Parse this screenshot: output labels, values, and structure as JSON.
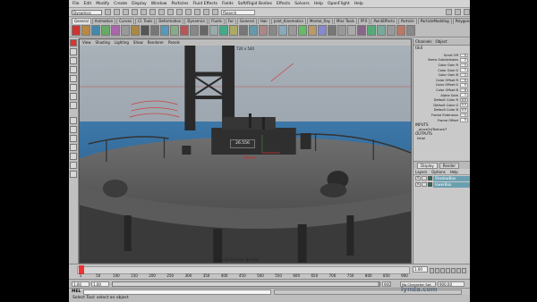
{
  "menubar": [
    "File",
    "Edit",
    "Modify",
    "Create",
    "Display",
    "Window",
    "Particles",
    "Fluid Effects",
    "Fields",
    "Soft/Rigid Bodies",
    "Effects",
    "Solvers",
    "Help",
    "OpenFlight",
    "Help"
  ],
  "statusline": {
    "mode": "Dynamics",
    "field_placeholder": "",
    "search_label": "fSearch"
  },
  "shelf_tabs": [
    "General",
    "Animation",
    "Curves",
    "Cl. Tools",
    "Deformation",
    "Dynamics",
    "Fluids",
    "Fur",
    "General",
    "Hair",
    "Joint_Kinematics",
    "Mental_Ray",
    "Misc Tools",
    "PFX",
    "PaintEffects",
    "Particle",
    "ParticleModding",
    "Polygons",
    "Poly",
    "Rendering",
    "SL",
    "Subdivs",
    "Surfaces",
    "Toon"
  ],
  "shelf_active_index": 0,
  "shelf_icons": [
    {
      "label": "",
      "color": "#c33"
    },
    {
      "label": "",
      "color": "#b84"
    },
    {
      "label": "",
      "color": "#48a"
    },
    {
      "label": "",
      "color": "#6a6"
    },
    {
      "label": "",
      "color": "#a6a"
    },
    {
      "label": "",
      "color": "#999"
    },
    {
      "label": "",
      "color": "#a84"
    },
    {
      "label": "",
      "color": "#555"
    },
    {
      "label": "",
      "color": "#777"
    },
    {
      "label": "",
      "color": "#59b"
    },
    {
      "label": "",
      "color": "#8a8"
    },
    {
      "label": "",
      "color": "#b55"
    },
    {
      "label": "",
      "color": "#888"
    },
    {
      "label": "",
      "color": "#666"
    },
    {
      "label": "",
      "color": "#9aa"
    },
    {
      "label": "",
      "color": "#4a8"
    },
    {
      "label": "",
      "color": "#aa6"
    },
    {
      "label": "",
      "color": "#777"
    },
    {
      "label": "",
      "color": "#69a"
    },
    {
      "label": "",
      "color": "#a88"
    },
    {
      "label": "",
      "color": "#888"
    },
    {
      "label": "",
      "color": "#8ab"
    },
    {
      "label": "",
      "color": "#999"
    },
    {
      "label": "",
      "color": "#6b6"
    },
    {
      "label": "",
      "color": "#b96"
    },
    {
      "label": "",
      "color": "#88c"
    },
    {
      "label": "",
      "color": "#777"
    },
    {
      "label": "",
      "color": "#999"
    },
    {
      "label": "",
      "color": "#aaa"
    },
    {
      "label": "",
      "color": "#868"
    },
    {
      "label": "",
      "color": "#5a7"
    },
    {
      "label": "",
      "color": "#7a9"
    },
    {
      "label": "",
      "color": "#999"
    },
    {
      "label": "",
      "color": "#b76"
    },
    {
      "label": "",
      "color": "#888"
    }
  ],
  "viewport": {
    "menu": [
      "View",
      "Shading",
      "Lighting",
      "Show",
      "Renderer",
      "Panels"
    ],
    "resolution": "720 x 540",
    "hud_readout": "26.556",
    "hud_label": "Move",
    "camera_label": ""
  },
  "channel_box": {
    "tabs": [
      "Channels",
      "Object"
    ],
    "object_name": "tikiI",
    "attributes": [
      {
        "name": "Scroll Off",
        "value": "0"
      },
      {
        "name": "Items Subdivisions",
        "value": "2"
      },
      {
        "name": "Color Gain R",
        "value": "1"
      },
      {
        "name": "Color Gain G",
        "value": "1"
      },
      {
        "name": "Color Gain B",
        "value": "1"
      },
      {
        "name": "Color Offset R",
        "value": "0"
      },
      {
        "name": "Color Offset G",
        "value": "0"
      },
      {
        "name": "Color Offset B",
        "value": "0"
      },
      {
        "name": "Alpha Gain",
        "value": "1"
      },
      {
        "name": "Default Color R",
        "value": "0.5"
      },
      {
        "name": "Default Color G",
        "value": "0.5"
      },
      {
        "name": "Default Color B",
        "value": "0.5"
      },
      {
        "name": "Frame Extension",
        "value": "1"
      },
      {
        "name": "Frame Offset",
        "value": "0"
      }
    ],
    "inputs_label": "INPUTS",
    "inputs_item": "_place2dTexture7",
    "outputs_label": "OUTPUTS",
    "outputs_item": "tikiol"
  },
  "layers": {
    "tabs": [
      "Display",
      "Render"
    ],
    "menu": [
      "Layers",
      "Options",
      "Help"
    ],
    "items": [
      {
        "visible": "V",
        "name": "ShadowBox",
        "color": "#2a6b5a"
      },
      {
        "visible": "V",
        "name": "lowerBox",
        "color": "#2a6b5a"
      }
    ]
  },
  "timeline": {
    "ticks": [
      "1",
      "50",
      "100",
      "150",
      "200",
      "250",
      "300",
      "350",
      "400",
      "450",
      "500",
      "550",
      "600",
      "650",
      "700",
      "750",
      "800",
      "850",
      "900"
    ],
    "current_frame": "1.00",
    "frame_start_value": 1,
    "frame_end_value": 900
  },
  "range": {
    "start": "1.00",
    "start_inner": "1.00",
    "end_inner": "900.00",
    "end": "900.00",
    "anim_layer": "No Character Set"
  },
  "cmdline": {
    "label": "MEL"
  },
  "helpline": "Select Tool: select an object",
  "scene_text": "Copy Dimension Bundle",
  "watermark": "lynda.com"
}
